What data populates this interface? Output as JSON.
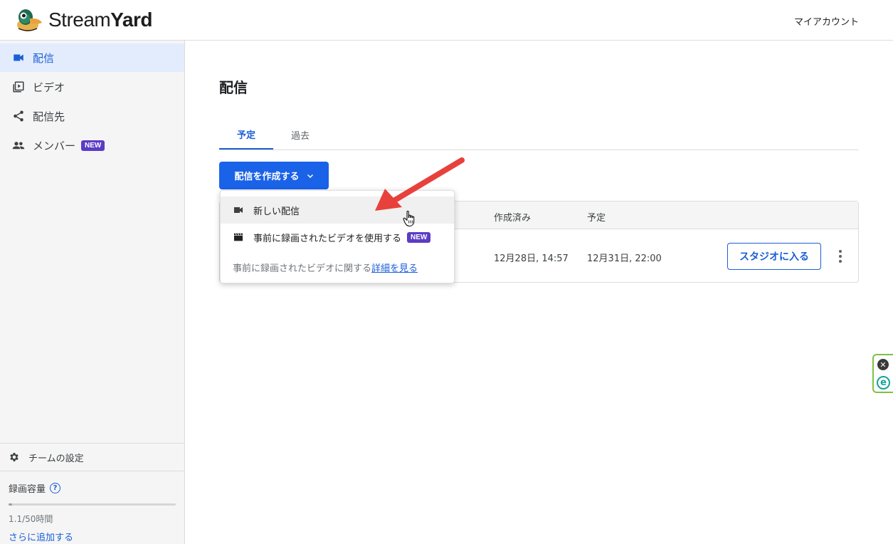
{
  "header": {
    "logo_light": "Stream",
    "logo_bold": "Yard",
    "account_label": "マイアカウント"
  },
  "sidebar": {
    "items": [
      {
        "label": "配信",
        "icon": "video-camera-icon",
        "active": true
      },
      {
        "label": "ビデオ",
        "icon": "video-library-icon",
        "active": false
      },
      {
        "label": "配信先",
        "icon": "share-icon",
        "active": false
      },
      {
        "label": "メンバー",
        "icon": "people-icon",
        "active": false,
        "badge": "NEW"
      }
    ],
    "team_settings_label": "チームの設定",
    "storage": {
      "title": "録画容量",
      "help_glyph": "?",
      "used_text": "1.1/50時間",
      "used_fraction": 0.022,
      "add_more_label": "さらに追加する"
    }
  },
  "main": {
    "title": "配信",
    "tabs": [
      {
        "label": "予定",
        "active": true
      },
      {
        "label": "過去",
        "active": false
      }
    ],
    "create_button_label": "配信を作成する",
    "table": {
      "columns": [
        "作成済み",
        "予定"
      ],
      "rows": [
        {
          "created": "12月28日, 14:57",
          "scheduled": "12月31日, 22:00",
          "studio_label": "スタジオに入る"
        }
      ]
    },
    "dropdown": {
      "items": [
        {
          "label": "新しい配信",
          "icon": "video-camera-icon"
        },
        {
          "label": "事前に録画されたビデオを使用する",
          "icon": "clapperboard-icon",
          "badge": "NEW"
        }
      ],
      "note_prefix": "事前に録画されたビデオに関する",
      "note_link": "詳細を見る"
    }
  },
  "extension": {
    "close_glyph": "✕",
    "letter": "e"
  },
  "colors": {
    "accent": "#1a62e8",
    "sidebar_active_bg": "#e3ecfd",
    "badge_purple": "#5b3cc4",
    "annotation_red": "#e8413c"
  }
}
